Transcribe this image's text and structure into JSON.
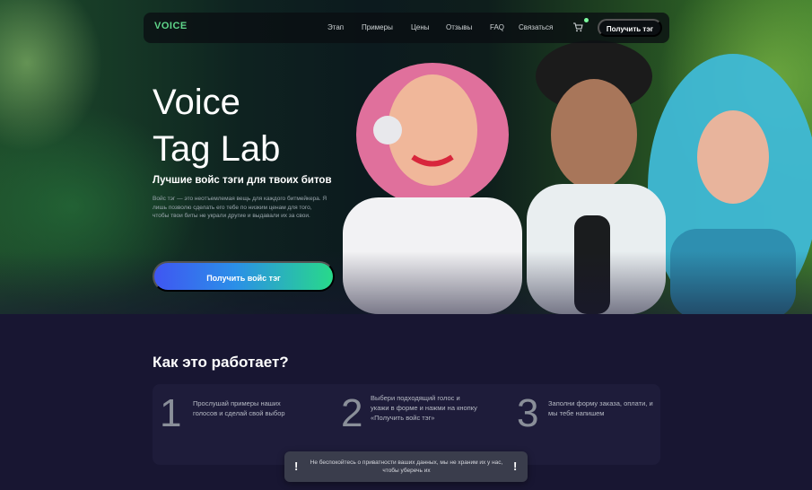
{
  "nav": {
    "logo": "VOICE",
    "links": [
      "Этап",
      "Примеры",
      "Цены",
      "Отзывы",
      "FAQ",
      "Связаться"
    ],
    "cta_label": "Получить тэг"
  },
  "hero": {
    "title_line1": "Voice",
    "title_line2": "Tag Lab",
    "subtitle": "Лучшие войс тэги для твоих битов",
    "description": "Войс тэг — это неотъемлемая вещь для каждого битмейкера. Я лишь позволю сделать его тебе по низким ценам для того, чтобы твои биты не украли другие и выдавали их за свои.",
    "cta_label": "Получить войс тэг"
  },
  "how": {
    "title": "Как это работает?",
    "steps": [
      {
        "number": "1",
        "text": "Прослушай примеры наших голосов и сделай свой выбор"
      },
      {
        "number": "2",
        "text": "Выбери подходящий голос и укажи в форме и нажми на кнопку «Получить войс тэг»"
      },
      {
        "number": "3",
        "text": "Заполни форму заказа, оплати, и мы тебе напишем"
      }
    ]
  },
  "toast": {
    "icon_left": "!",
    "icon_right": "!",
    "text": "Не беспокойтесь о приватности ваших данных, мы не храним их у нас, чтобы уберечь их"
  },
  "colors": {
    "page_bg": "#181632",
    "accent_green": "#28d98a",
    "accent_blue": "#3f56f2"
  }
}
